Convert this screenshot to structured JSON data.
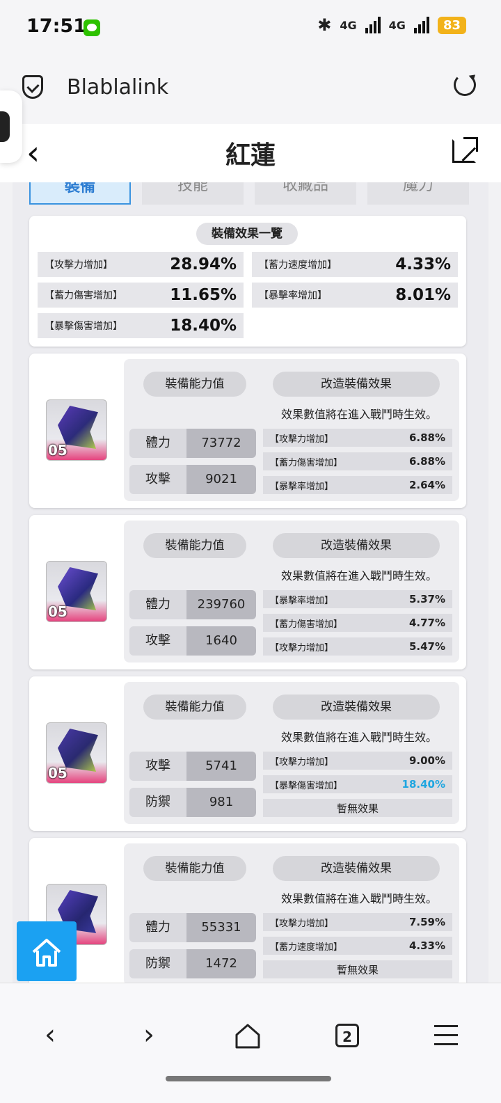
{
  "status_bar": {
    "time": "17:51",
    "network": "4G",
    "battery": "83"
  },
  "browser": {
    "site_name": "Blablalink"
  },
  "header": {
    "title": "紅蓮"
  },
  "tabs": [
    "裝備",
    "技能",
    "收藏品",
    "魔力"
  ],
  "summary": {
    "title": "裝備效果一覽",
    "stats": [
      {
        "label": "【攻擊力增加】",
        "value": "28.94%"
      },
      {
        "label": "【蓄力速度增加】",
        "value": "4.33%"
      },
      {
        "label": "【蓄力傷害增加】",
        "value": "11.65%"
      },
      {
        "label": "【暴擊率增加】",
        "value": "8.01%"
      },
      {
        "label": "【暴擊傷害增加】",
        "value": "18.40%"
      }
    ]
  },
  "card_labels": {
    "ability_title": "裝備能力值",
    "modify_title": "改造裝備效果",
    "note": "效果數值將在進入戰鬥時生效。"
  },
  "equipment": [
    {
      "level": "05",
      "stats": [
        {
          "label": "體力",
          "value": "73772"
        },
        {
          "label": "攻擊",
          "value": "9021"
        }
      ],
      "effects": [
        {
          "label": "【攻擊力增加】",
          "value": "6.88%"
        },
        {
          "label": "【蓄力傷害增加】",
          "value": "6.88%"
        },
        {
          "label": "【暴擊率增加】",
          "value": "2.64%"
        }
      ]
    },
    {
      "level": "05",
      "stats": [
        {
          "label": "體力",
          "value": "239760"
        },
        {
          "label": "攻擊",
          "value": "1640"
        }
      ],
      "effects": [
        {
          "label": "【暴擊率增加】",
          "value": "5.37%"
        },
        {
          "label": "【蓄力傷害增加】",
          "value": "4.77%"
        },
        {
          "label": "【攻擊力增加】",
          "value": "5.47%"
        }
      ]
    },
    {
      "level": "05",
      "stats": [
        {
          "label": "攻擊",
          "value": "5741"
        },
        {
          "label": "防禦",
          "value": "981"
        }
      ],
      "effects": [
        {
          "label": "【攻擊力增加】",
          "value": "9.00%"
        },
        {
          "label": "【暴擊傷害增加】",
          "value": "18.40%",
          "highlight": "#1fa6e0"
        },
        {
          "label": "暫無效果"
        }
      ]
    },
    {
      "level": "",
      "stats": [
        {
          "label": "體力",
          "value": "55331"
        },
        {
          "label": "防禦",
          "value": "1472"
        }
      ],
      "effects": [
        {
          "label": "【攻擊力增加】",
          "value": "7.59%"
        },
        {
          "label": "【蓄力速度增加】",
          "value": "4.33%"
        },
        {
          "label": "暫無效果"
        }
      ]
    }
  ],
  "bottom_nav": {
    "tab_count": "2"
  },
  "icons": [
    "shield-check-icon",
    "reload-icon",
    "back-arrow-icon",
    "share-icon",
    "home-icon",
    "nav-back-icon",
    "nav-forward-icon",
    "nav-home-icon",
    "tabs-icon",
    "menu-icon"
  ]
}
